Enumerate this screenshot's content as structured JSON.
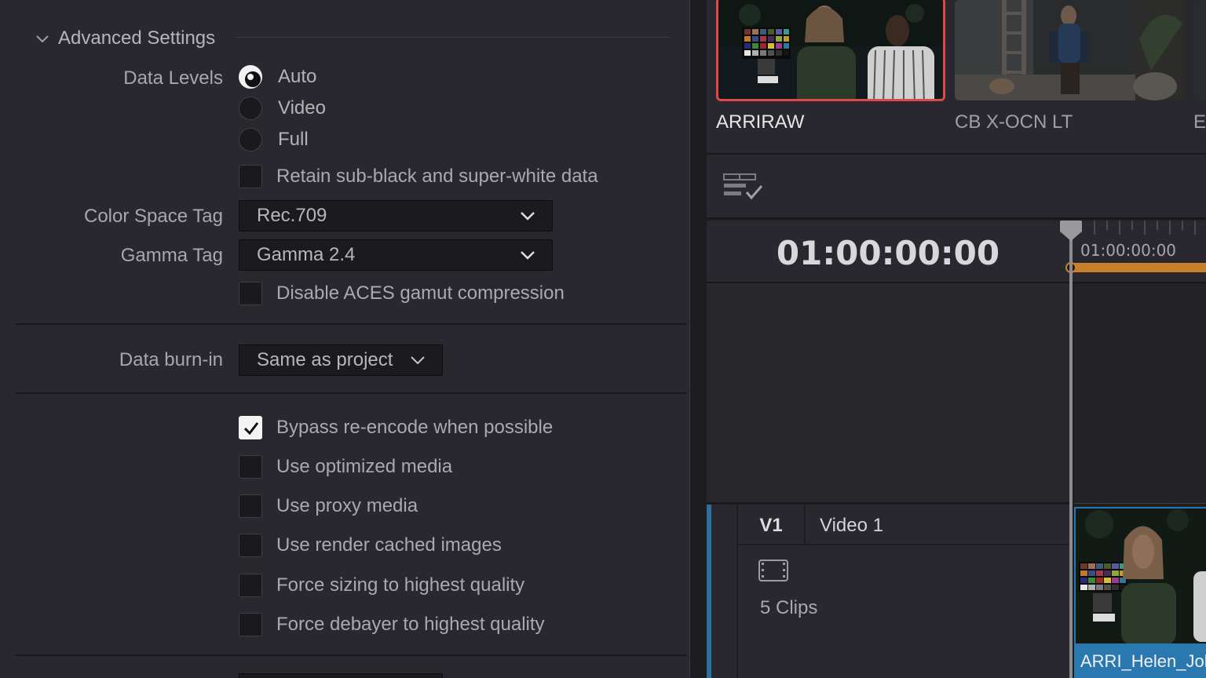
{
  "advanced_settings": {
    "title": "Advanced Settings",
    "data_levels": {
      "label": "Data Levels",
      "options": [
        "Auto",
        "Video",
        "Full"
      ],
      "selected": "Auto"
    },
    "retain_checkbox": {
      "label": "Retain sub-black and super-white data",
      "checked": false
    },
    "color_space_tag": {
      "label": "Color Space Tag",
      "value": "Rec.709"
    },
    "gamma_tag": {
      "label": "Gamma Tag",
      "value": "Gamma 2.4"
    },
    "disable_aces": {
      "label": "Disable ACES gamut compression",
      "checked": false
    },
    "data_burn_in": {
      "label": "Data burn-in",
      "value": "Same as project"
    },
    "options": [
      {
        "label": "Bypass re-encode when possible",
        "checked": true
      },
      {
        "label": "Use optimized media",
        "checked": false
      },
      {
        "label": "Use proxy media",
        "checked": false
      },
      {
        "label": "Use render cached images",
        "checked": false
      },
      {
        "label": "Force sizing to highest quality",
        "checked": false
      },
      {
        "label": "Force debayer to highest quality",
        "checked": false
      }
    ]
  },
  "media": {
    "clips": [
      {
        "label": "ARRIRAW",
        "selected": true
      },
      {
        "label": "CB X-OCN LT",
        "selected": false
      },
      {
        "label": "EX",
        "selected": false
      }
    ]
  },
  "timeline": {
    "timecode": "01:00:00:00",
    "ruler_timecode": "01:00:00:00",
    "track": {
      "id": "V1",
      "name": "Video 1",
      "clip_count": "5 Clips"
    },
    "clip_name": "ARRI_Helen_John"
  },
  "colors": {
    "panel_bg": "#28282e",
    "selection_red": "#e04848",
    "playhead_orange": "#c9802a",
    "track_blue": "#2f6f9d"
  }
}
